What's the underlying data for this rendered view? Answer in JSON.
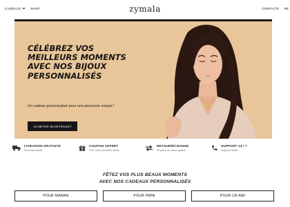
{
  "header": {
    "nav_left": [
      {
        "label": "Cadeaux",
        "has_dropdown": true
      },
      {
        "label": "Shop",
        "has_dropdown": false
      }
    ],
    "logo": "zymala",
    "nav_right": [
      {
        "label": "Contacts"
      },
      {
        "label": "Re"
      }
    ]
  },
  "hero": {
    "headline_lines": [
      "Célébrez vos",
      "meilleurs moments",
      "avec nos bijoux",
      "personnalisés"
    ],
    "subtitle": "Un cadeau personnalisé pour une personne unique !",
    "cta_label": "Acheter maintenant",
    "background_color": "#e8c699"
  },
  "features": [
    {
      "icon": "truck-icon",
      "title": "Livraison gratuite",
      "subtitle": "Pour tout achat"
    },
    {
      "icon": "gift-icon",
      "title": "Coupon offert",
      "subtitle": "Pour votre prochain achat"
    },
    {
      "icon": "exchange-icon",
      "title": "Retour/Échange",
      "subtitle": "30 jours de retour gratuit"
    },
    {
      "icon": "phone-icon",
      "title": "Support 24 / 7",
      "subtitle": "Support dédié"
    }
  ],
  "section": {
    "title_line1": "Fêtez vos plus beaux moments",
    "title_line2": "avec nos cadeaux personnalisés"
  },
  "categories": [
    {
      "label": "Pour Maman"
    },
    {
      "label": "Pour Papa"
    },
    {
      "label": "Pour un ami"
    }
  ]
}
